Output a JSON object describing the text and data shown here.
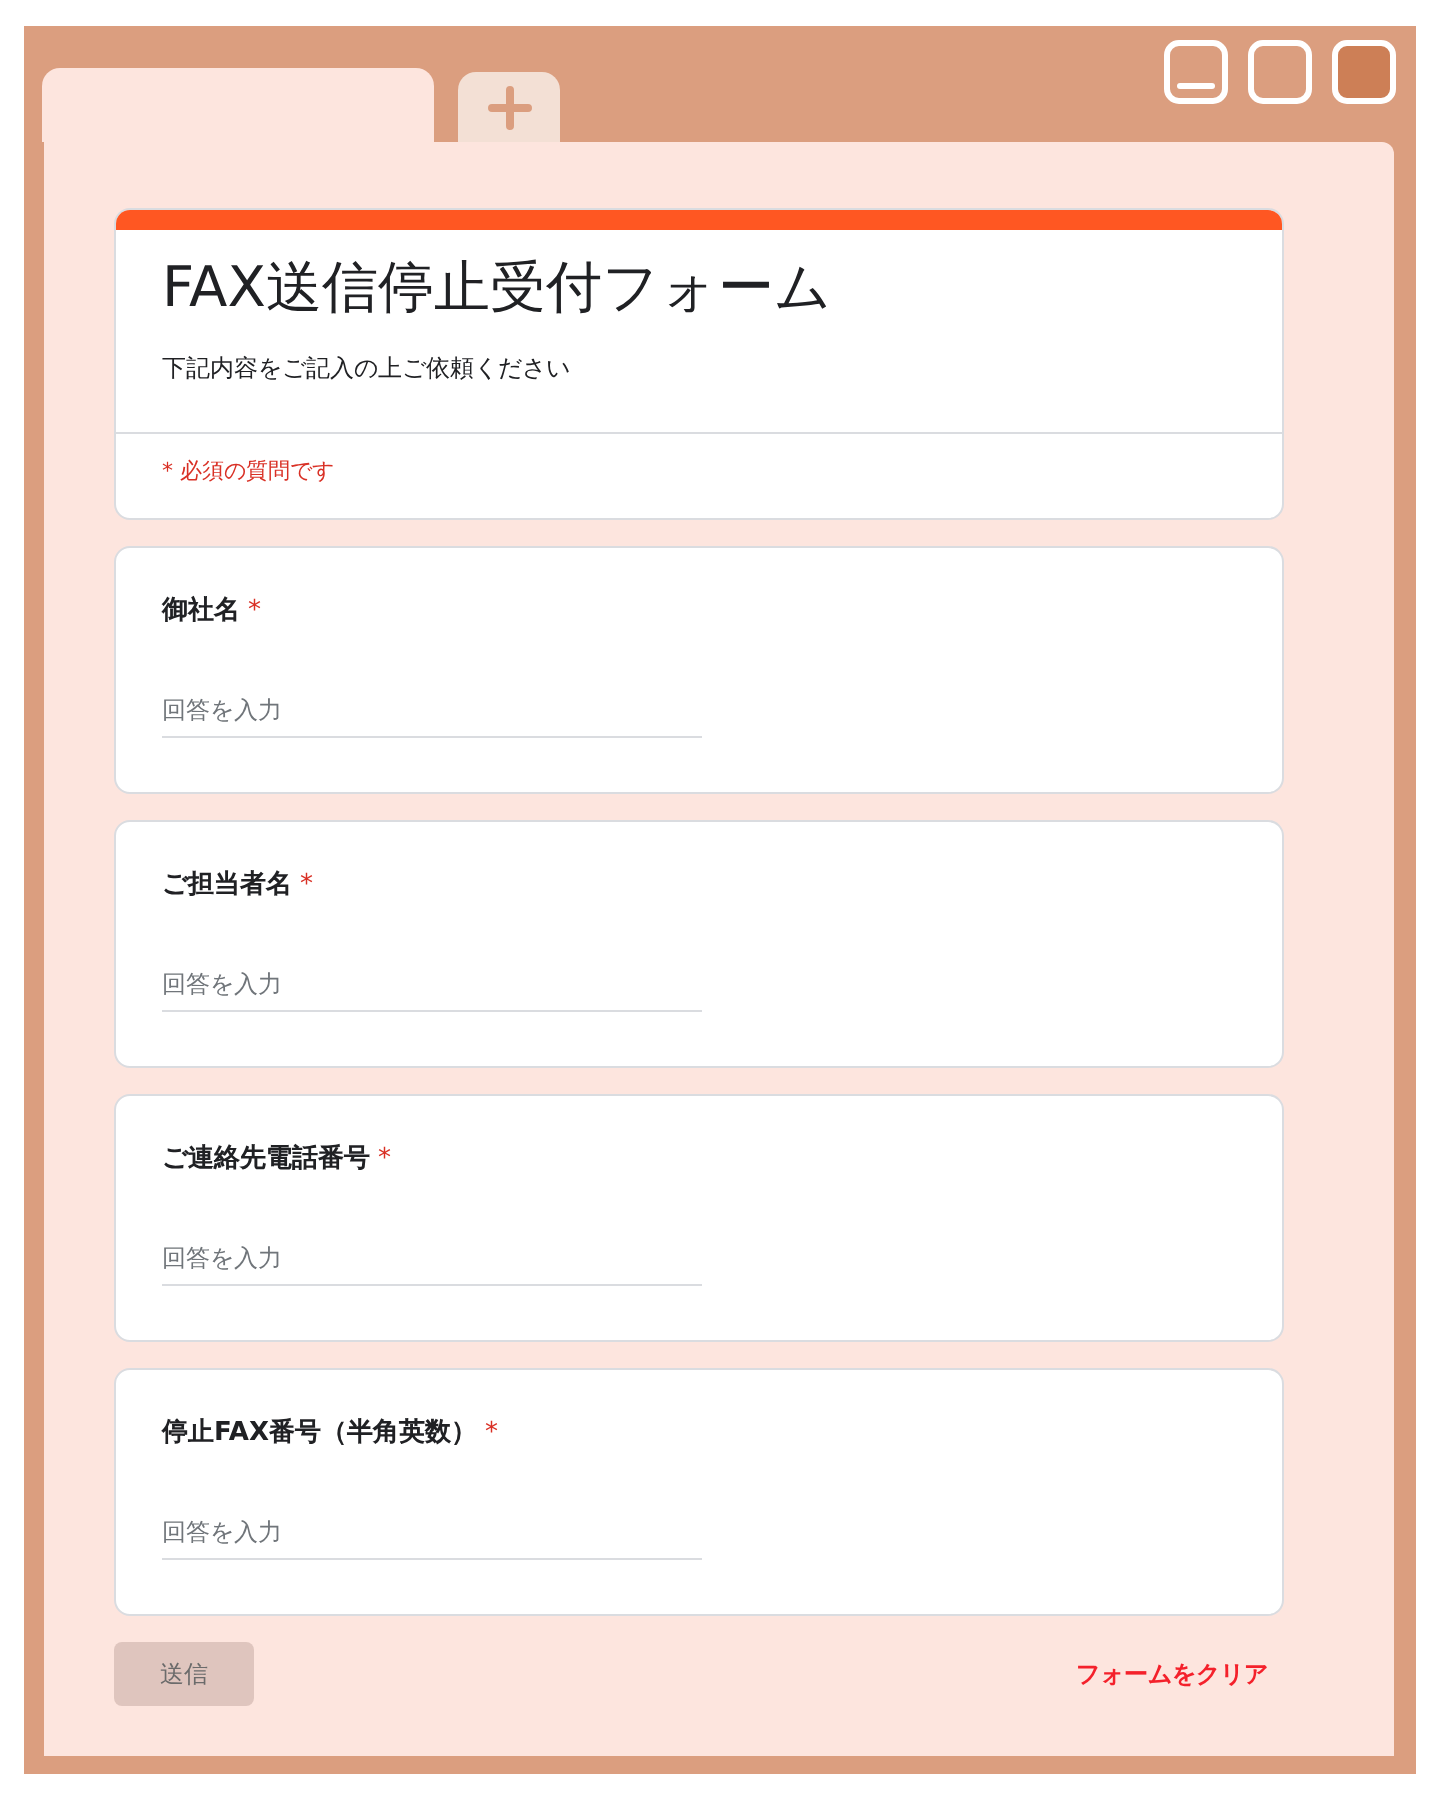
{
  "window": {
    "tabs": [
      {
        "selected": true
      }
    ]
  },
  "form": {
    "header": {
      "title": "FAX送信停止受付フォーム",
      "description": "下記内容をご記入の上ご依頼ください",
      "required_note": "* 必須の質問です"
    },
    "questions": [
      {
        "label": "御社名",
        "required_mark": "*",
        "placeholder": "回答を入力"
      },
      {
        "label": "ご担当者名",
        "required_mark": "*",
        "placeholder": "回答を入力"
      },
      {
        "label": "ご連絡先電話番号",
        "required_mark": "*",
        "placeholder": "回答を入力"
      },
      {
        "label": "停止FAX番号（半角英数）",
        "required_mark": "*",
        "placeholder": "回答を入力"
      }
    ],
    "submit_button": {
      "label": "送信",
      "disabled": true
    },
    "clear_link": "フォームをクリア"
  }
}
